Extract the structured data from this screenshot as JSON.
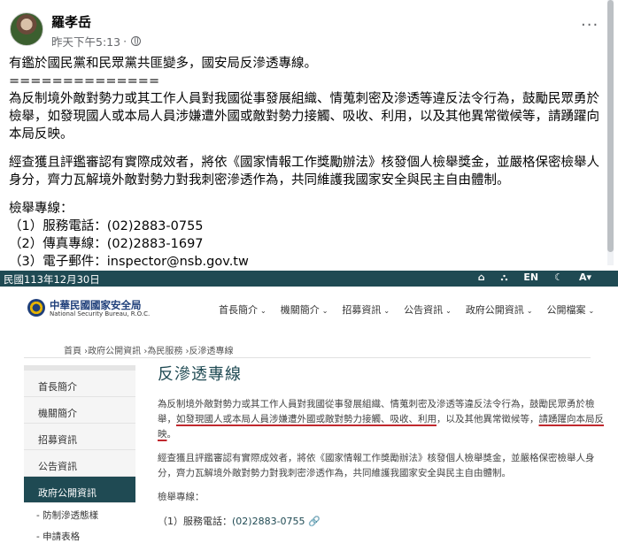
{
  "post": {
    "author": "羅孝岳",
    "timestamp": "昨天下午5:13",
    "more_label": "···",
    "para1": "有鑑於國民黨和民眾黨共匪變多，國安局反滲透專線。",
    "separator": "==============",
    "para2": "為反制境外敵對勢力或其工作人員對我國從事發展組織、情蒐刺密及滲透等違反法令行為，鼓勵民眾勇於檢舉，如發現國人或本局人員涉嫌遭外國或敵對勢力接觸、吸收、利用，以及其他異常徵候等，請踴躍向本局反映。",
    "para3": "經查獲且評鑑審認有實際成效者，將依《國家情報工作獎勵辦法》核發個人檢舉獎金，並嚴格保密檢舉人身分，齊力瓦解境外敵對勢力對我刺密滲透作為，共同維護我國家安全與民主自由體制。",
    "hotline_title": "檢舉專線：",
    "hotline_1": "（1）服務電話：(02)2883-0755",
    "hotline_2": "（2）傳真專線：(02)2883-1697",
    "hotline_3": "（3）電子郵件：inspector@nsb.gov.tw"
  },
  "site": {
    "date": "民國113年12月30日",
    "tools": [
      "⌂",
      "⛬",
      "EN",
      "☾",
      "A▾"
    ],
    "logo_cn": "中華民國國家安全局",
    "logo_en": "National Security Bureau, R.O.C.",
    "nav": [
      "首長簡介",
      "機關簡介",
      "招募資訊",
      "公告資訊",
      "政府公開資訊",
      "公開檔案"
    ],
    "breadcrumb": "首頁 ›政府公開資訊 ›為民服務 ›反滲透專線",
    "sidebar": [
      "首長簡介",
      "機關簡介",
      "招募資訊",
      "公告資訊",
      "政府公開資訊"
    ],
    "sidebar_sub": [
      "- 防制滲透態樣",
      "- 申請表格"
    ],
    "title": "反滲透專線",
    "text1_a": "為反制境外敵對勢力或其工作人員對我國從事發展組織、情蒐刺密及滲透等違反法令行為，鼓勵民眾勇於檢舉，",
    "text1_b": "如發現國人或本局人員涉嫌遭外國或敵對勢力接觸、吸收、利用",
    "text1_c": "，以及其他異常徵候等，",
    "text1_d": "請踴躍向本局反映",
    "text1_e": "。",
    "text2": "經查獲且評鑑審認有實際成效者，將依《國家情報工作獎勵辦法》核發個人檢舉獎金，並嚴格保密檢舉人身分，齊力瓦解境外敵對勢力對我刺密滲透作為，共同維護我國家安全與民主自由體制。",
    "hotline_title": "檢舉專線：",
    "phone_label": "（1）服務電話：",
    "phone_value": "(02)2883-0755",
    "link_icon": "🔗"
  }
}
